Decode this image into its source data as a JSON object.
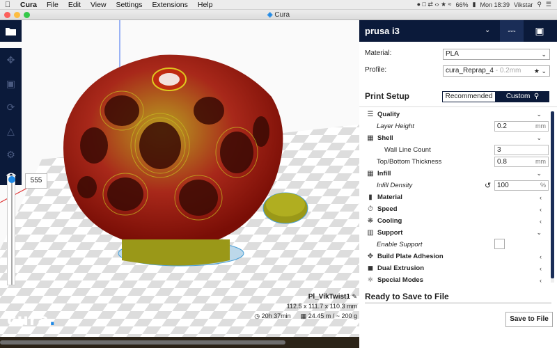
{
  "menubar": {
    "app_name": "Cura",
    "items": [
      "File",
      "Edit",
      "View",
      "Settings",
      "Extensions",
      "Help"
    ],
    "battery": "66%",
    "clock": "Mon 18:39",
    "user": "Vikstar"
  },
  "window": {
    "title": "Cura"
  },
  "viewport": {
    "layer_number": "555",
    "job_name": "Pl_VikTwist1",
    "dimensions": "112.5 x 111.7 x 110.3 mm",
    "print_time": "20h 37min",
    "material_usage": "24.45 m / ~ 200 g"
  },
  "logo": {
    "text": "cura",
    "dot": "."
  },
  "panel": {
    "printer_name": "prusa i3",
    "material_label": "Material:",
    "material_value": "PLA",
    "profile_label": "Profile:",
    "profile_value": "cura_Reprap_4",
    "profile_hint": "- 0.2mm",
    "print_setup_title": "Print Setup",
    "mode_recommended": "Recommended",
    "mode_custom": "Custom",
    "ready_text": "Ready to Save to File",
    "save_button": "Save to File"
  },
  "settings": {
    "quality": "Quality",
    "layer_height_label": "Layer Height",
    "layer_height_value": "0.2",
    "layer_height_unit": "mm",
    "shell": "Shell",
    "wall_line_count_label": "Wall Line Count",
    "wall_line_count_value": "3",
    "top_bottom_label": "Top/Bottom Thickness",
    "top_bottom_value": "0.8",
    "top_bottom_unit": "mm",
    "infill": "Infill",
    "infill_density_label": "Infill Density",
    "infill_density_value": "100",
    "infill_density_unit": "%",
    "material": "Material",
    "speed": "Speed",
    "cooling": "Cooling",
    "support": "Support",
    "enable_support_label": "Enable Support",
    "build_plate": "Build Plate Adhesion",
    "dual_extrusion": "Dual Extrusion",
    "special_modes": "Special Modes"
  },
  "colors": {
    "accent": "#1e88e5",
    "navy": "#0b1a3a",
    "model_red": "#b01a0e",
    "model_yellow": "#a0a818"
  }
}
